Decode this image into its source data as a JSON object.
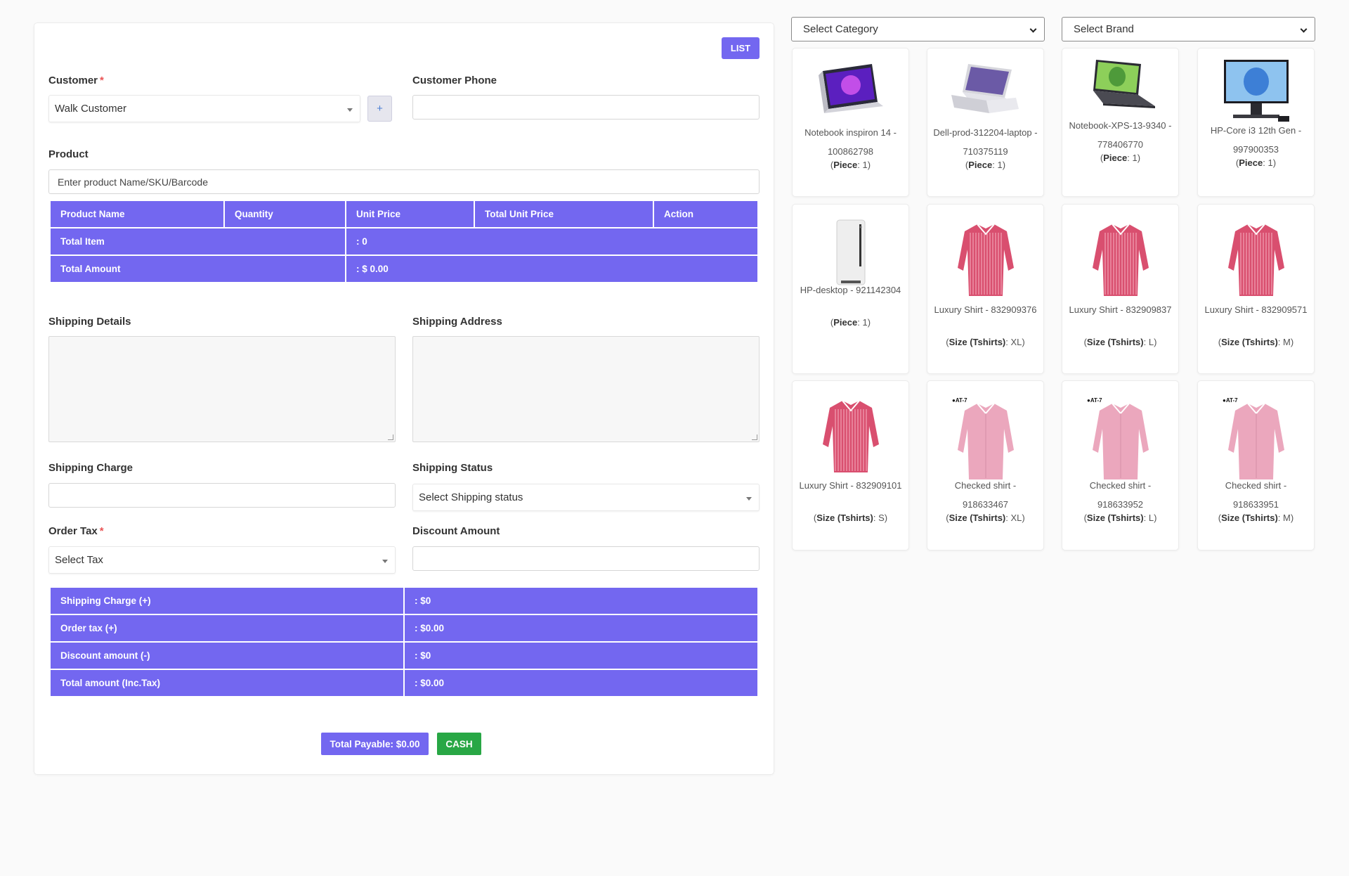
{
  "header": {
    "list_button": "LIST"
  },
  "customer": {
    "label": "Customer",
    "required": "*",
    "value": "Walk Customer",
    "add_button": "+"
  },
  "customer_phone": {
    "label": "Customer Phone",
    "value": ""
  },
  "product": {
    "label": "Product",
    "placeholder": "Enter product Name/SKU/Barcode"
  },
  "product_table": {
    "headers": [
      "Product Name",
      "Quantity",
      "Unit Price",
      "Total Unit Price",
      "Action"
    ],
    "total_item_label": "Total Item",
    "total_item_value": ": 0",
    "total_amount_label": "Total Amount",
    "total_amount_value": ": $ 0.00"
  },
  "shipping_details": {
    "label": "Shipping Details"
  },
  "shipping_address": {
    "label": "Shipping Address"
  },
  "shipping_charge": {
    "label": "Shipping Charge",
    "value": ""
  },
  "shipping_status": {
    "label": "Shipping Status",
    "value": "Select Shipping status"
  },
  "order_tax": {
    "label": "Order Tax",
    "required": "*",
    "value": "Select Tax"
  },
  "discount_amount": {
    "label": "Discount Amount",
    "value": ""
  },
  "summary": [
    {
      "label": "Shipping Charge (+)",
      "value": ": $0"
    },
    {
      "label": "Order tax (+)",
      "value": ": $0.00"
    },
    {
      "label": "Discount amount (-)",
      "value": ": $0"
    },
    {
      "label": "Total amount (Inc.Tax)",
      "value": ": $0.00"
    }
  ],
  "footer": {
    "payable": "Total Payable: $0.00",
    "cash": "CASH"
  },
  "filters": {
    "category": "Select Category",
    "brand": "Select Brand"
  },
  "products": [
    {
      "name": "Notebook inspiron 14 - 100862798",
      "attr": "Piece",
      "val": "1",
      "icon": "laptop-flip"
    },
    {
      "name": "Dell-prod-312204-laptop - 710375119",
      "attr": "Piece",
      "val": "1",
      "icon": "laptop-silver"
    },
    {
      "name": "Notebook-XPS-13-9340 - 778406770",
      "attr": "Piece",
      "val": "1",
      "icon": "laptop-dark"
    },
    {
      "name": "HP-Core i3 12th Gen - 997900353",
      "attr": "Piece",
      "val": "1",
      "icon": "desktop-monitor"
    },
    {
      "name": "HP-desktop - 921142304",
      "attr": "Piece",
      "val": "1",
      "icon": "desktop-tower"
    },
    {
      "name": "Luxury Shirt - 832909376",
      "attr": "Size (Tshirts)",
      "val": "XL",
      "icon": "shirt-red"
    },
    {
      "name": "Luxury Shirt - 832909837",
      "attr": "Size (Tshirts)",
      "val": "L",
      "icon": "shirt-red"
    },
    {
      "name": "Luxury Shirt - 832909571",
      "attr": "Size (Tshirts)",
      "val": "M",
      "icon": "shirt-red"
    },
    {
      "name": "Luxury Shirt - 832909101",
      "attr": "Size (Tshirts)",
      "val": "S",
      "icon": "shirt-red"
    },
    {
      "name": "Checked shirt - 918633467",
      "attr": "Size (Tshirts)",
      "val": "XL",
      "icon": "shirt-pink"
    },
    {
      "name": "Checked shirt - 918633952",
      "attr": "Size (Tshirts)",
      "val": "L",
      "icon": "shirt-pink"
    },
    {
      "name": "Checked shirt - 918633951",
      "attr": "Size (Tshirts)",
      "val": "M",
      "icon": "shirt-pink"
    }
  ],
  "colors": {
    "accent": "#7367f0",
    "cash": "#28a745",
    "required": "#ea5455"
  }
}
